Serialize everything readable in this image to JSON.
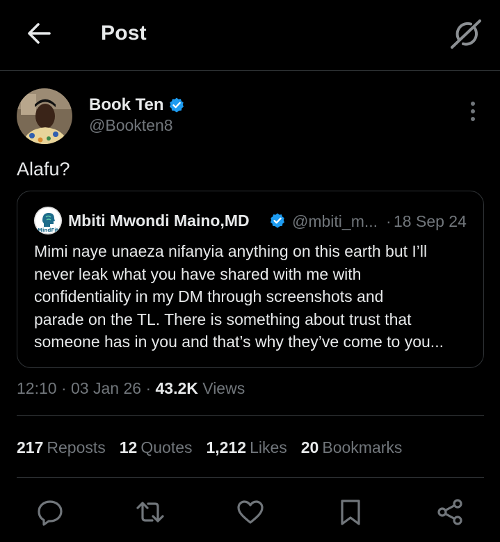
{
  "header": {
    "title": "Post",
    "back_icon": "back-arrow-icon",
    "grok_icon": "grok-icon"
  },
  "post": {
    "author_name": "Book Ten",
    "author_handle": "@Bookten8",
    "verified": true,
    "text": "Alafu?",
    "quote": {
      "author_name": "Mbiti Mwondi Maino,MD",
      "author_handle": "@mbiti_m...",
      "separator": "·",
      "date": "18 Sep 24",
      "avatar_label": "MindFit",
      "verified": true,
      "lines": [
        "Mimi naye unaeza nifanyia anything on this earth but I’ll",
        "never leak what you have shared with me with",
        "confidentiality in my DM through screenshots and",
        "parade on the TL. There is something about trust that",
        "someone has in you and that’s why they’ve come to you..."
      ]
    },
    "meta": {
      "time": "12:10",
      "separator": "·",
      "date": "03 Jan 26",
      "views_count": "43.2K",
      "views_label": "Views"
    },
    "stats": [
      {
        "count": "217",
        "label": "Reposts"
      },
      {
        "count": "12",
        "label": "Quotes"
      },
      {
        "count": "1,212",
        "label": "Likes"
      },
      {
        "count": "20",
        "label": "Bookmarks"
      }
    ]
  },
  "actions": [
    "reply-icon",
    "repost-icon",
    "like-icon",
    "bookmark-icon",
    "share-icon"
  ],
  "colors": {
    "background": "#000000",
    "text_primary": "#e7e9ea",
    "text_secondary": "#71767b",
    "border": "#2f3336",
    "verified_blue": "#1d9bf0"
  }
}
